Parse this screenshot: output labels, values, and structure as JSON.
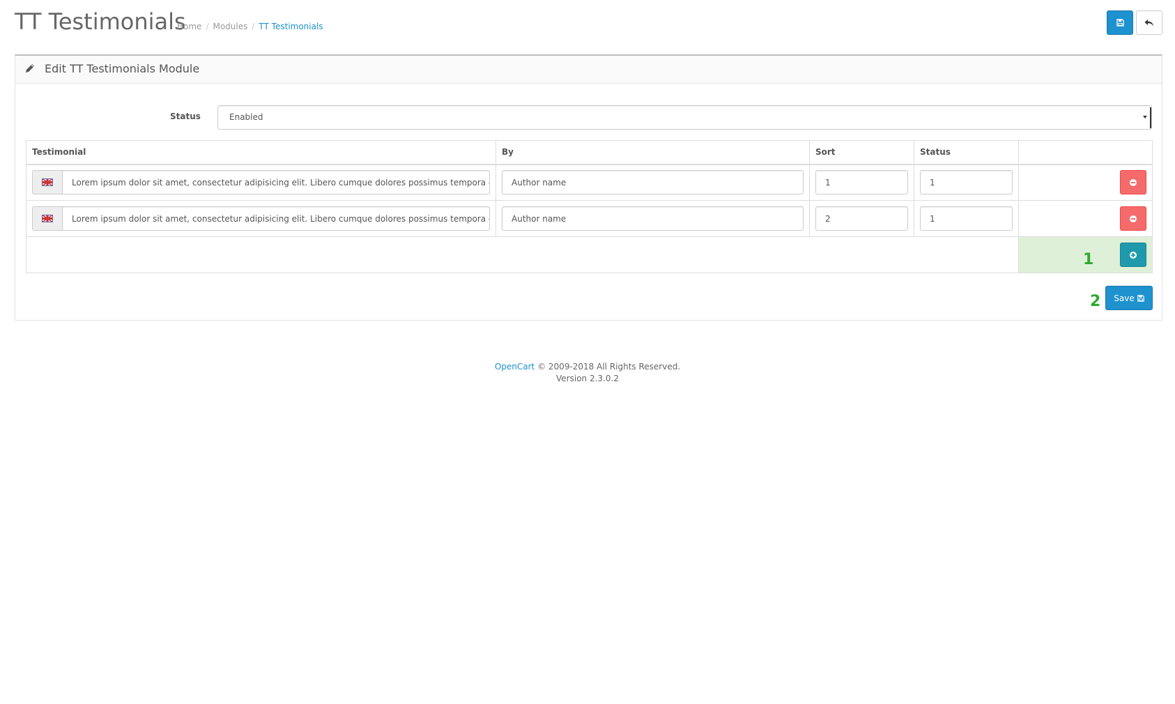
{
  "header": {
    "title": "TT Testimonials",
    "breadcrumb": [
      "Home",
      "Modules",
      "TT Testimonials"
    ],
    "save_icon": "save-icon",
    "back_icon": "reply-icon"
  },
  "panel": {
    "title": "Edit TT Testimonials Module",
    "icon": "pencil-icon"
  },
  "form": {
    "status_label": "Status",
    "status_value": "Enabled"
  },
  "table": {
    "columns": [
      "Testimonial",
      "By",
      "Sort",
      "Status"
    ],
    "rows": [
      {
        "flag": "uk-flag-icon",
        "testimonial": "Lorem ipsum dolor sit amet, consectetur adipisicing elit. Libero cumque dolores possimus tempora eum necessitat",
        "by": "Author name",
        "sort": "1",
        "status": "1"
      },
      {
        "flag": "uk-flag-icon",
        "testimonial": "Lorem ipsum dolor sit amet, consectetur adipisicing elit. Libero cumque dolores possimus tempora eum necessitat",
        "by": "Author name",
        "sort": "2",
        "status": "1"
      }
    ]
  },
  "markers": {
    "one": "1",
    "two": "2"
  },
  "save_button": {
    "label": "Save"
  },
  "footer": {
    "link": "OpenCart",
    "copyright": "© 2009-2018 All Rights Reserved.",
    "version": "Version 2.3.0.2"
  },
  "colors": {
    "primary": "#1e91cf",
    "danger": "#f56b6b",
    "info": "#1f9aac",
    "success_bg": "#dff0d8",
    "marker": "#2eaa2e"
  }
}
